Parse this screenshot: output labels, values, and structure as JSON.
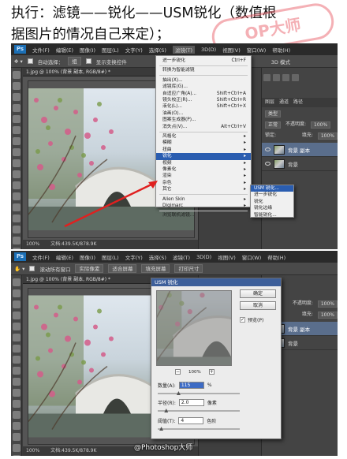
{
  "headline": {
    "line1": "执行：滤镜——锐化——USM锐化（数值根",
    "line2": "据图片的情况自己来定）；"
  },
  "watermark": "OP大师",
  "menubar": {
    "logo": "Ps",
    "items": [
      "文件(F)",
      "编辑(E)",
      "图像(I)",
      "图层(L)",
      "文字(Y)",
      "选择(S)",
      "滤镜(T)",
      "3D(D)",
      "视图(V)",
      "窗口(W)",
      "帮助(H)"
    ]
  },
  "optionbar1": {
    "auto_select": "自动选择：",
    "auto_select_value": "组",
    "show_transform": "显示变换控件",
    "workspace": "3D 模式"
  },
  "optionbar2": {
    "scroll_all": "滚动所有窗口",
    "actual_pixels": "实际像素",
    "fit_screen": "适合屏幕",
    "fill_screen": "填充屏幕",
    "print_size": "打印尺寸"
  },
  "document": {
    "tab": "1.jpg @ 100% (背景 副本, RGB/8#) *",
    "zoom": "100%",
    "doc_size": "文档:439.5K/878.9K"
  },
  "panels": {
    "tabs": [
      "图层",
      "通道",
      "路径"
    ],
    "kind": "类型",
    "blend": "正常",
    "opacity_label": "不透明度:",
    "opacity": "100%",
    "lock_label": "锁定:",
    "fill_label": "填充:",
    "fill": "100%",
    "layers": [
      {
        "name": "背景 副本",
        "selected": true
      },
      {
        "name": "背景",
        "selected": false
      }
    ]
  },
  "filter_menu": {
    "items": [
      {
        "label": "进一步锐化",
        "shortcut": "Ctrl+F"
      },
      {
        "sep": true
      },
      {
        "label": "转换为智能滤镜",
        "shortcut": ""
      },
      {
        "sep": true
      },
      {
        "label": "抽出(X)...",
        "shortcut": ""
      },
      {
        "label": "滤镜库(G)...",
        "shortcut": ""
      },
      {
        "label": "自适应广角(A)...",
        "shortcut": "Shift+Ctrl+A"
      },
      {
        "label": "镜头校正(R)...",
        "shortcut": "Shift+Ctrl+R"
      },
      {
        "label": "液化(L)...",
        "shortcut": "Shift+Ctrl+X"
      },
      {
        "label": "油画(O)...",
        "shortcut": ""
      },
      {
        "label": "图案生成器(P)...",
        "shortcut": ""
      },
      {
        "label": "消失点(V)...",
        "shortcut": "Alt+Ctrl+V"
      },
      {
        "sep": true
      },
      {
        "label": "风格化",
        "shortcut": "▸"
      },
      {
        "label": "模糊",
        "shortcut": "▸"
      },
      {
        "label": "扭曲",
        "shortcut": "▸"
      },
      {
        "label": "锐化",
        "shortcut": "▸",
        "highlight": true
      },
      {
        "label": "视频",
        "shortcut": "▸"
      },
      {
        "label": "像素化",
        "shortcut": "▸"
      },
      {
        "label": "渲染",
        "shortcut": "▸"
      },
      {
        "label": "杂色",
        "shortcut": "▸"
      },
      {
        "label": "其它",
        "shortcut": "▸"
      },
      {
        "sep": true
      },
      {
        "label": "Alien Skin",
        "shortcut": "▸"
      },
      {
        "label": "Digimarc",
        "shortcut": "▸"
      },
      {
        "sep": true
      },
      {
        "label": "浏览联机滤镜...",
        "shortcut": ""
      }
    ]
  },
  "sharpen_submenu": [
    "USM 锐化...",
    "进一步锐化",
    "锐化",
    "锐化边缘",
    "智能锐化..."
  ],
  "usm_dialog": {
    "title": "USM 锐化",
    "ok": "确定",
    "cancel": "取消",
    "preview_label": "预览(P)",
    "preview_checked": true,
    "zoom": "100%",
    "amount_label": "数量(A):",
    "amount_value": "115",
    "amount_unit": "%",
    "amount_level": 0.23,
    "radius_label": "半径(R):",
    "radius_value": "2.0",
    "radius_unit": "像素",
    "radius_level": 0.08,
    "threshold_label": "阈值(T):",
    "threshold_value": "4",
    "threshold_unit": "色阶",
    "threshold_level": 0.02
  },
  "caption": "@Photoshop大师",
  "colors": {
    "ps_bg": "#3c3c3c",
    "menu_highlight": "#2a5db0",
    "selected_layer": "#5a6e8c",
    "arrow_red": "#e0201f",
    "watermark": "#e6505a"
  }
}
